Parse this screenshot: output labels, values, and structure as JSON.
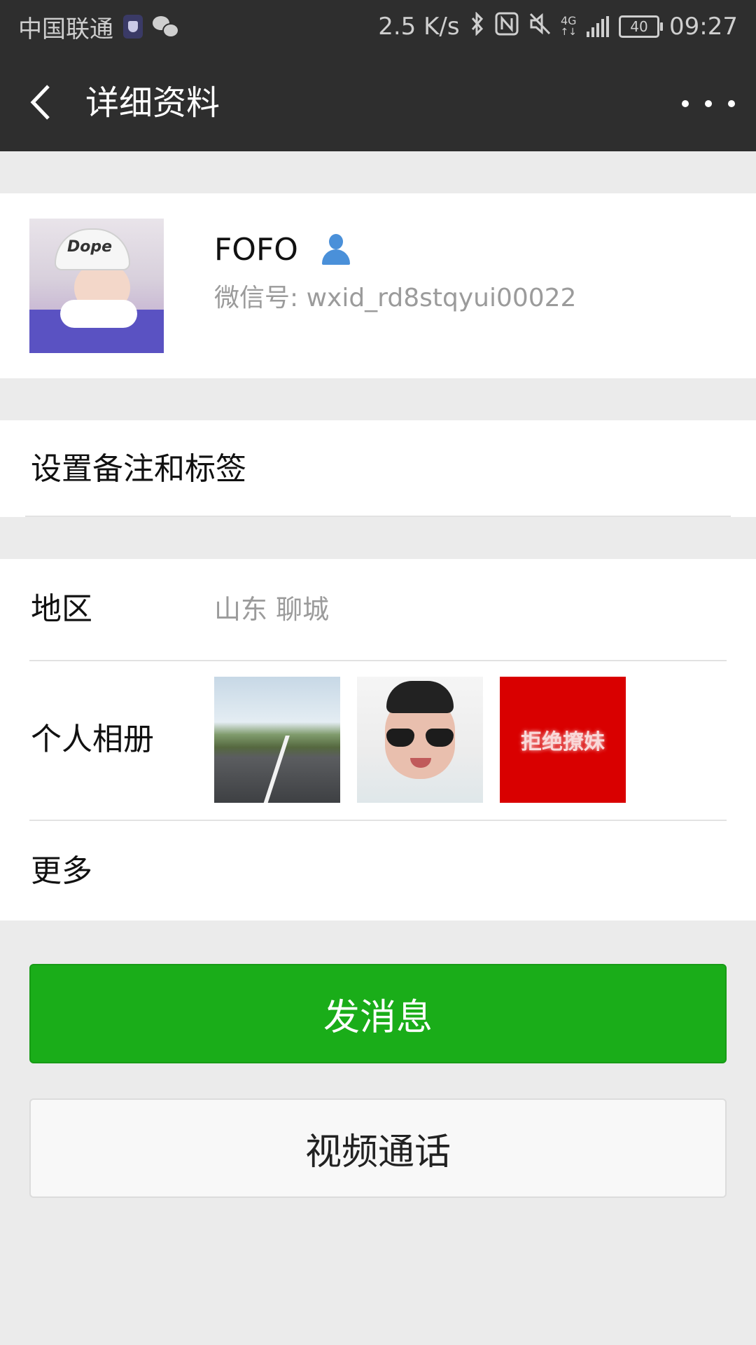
{
  "status_bar": {
    "carrier": "中国联通",
    "speed": "2.5 K/s",
    "network": "4G",
    "battery": "40",
    "time": "09:27",
    "icons": [
      "shield-icon",
      "wechat-icon",
      "bluetooth-icon",
      "nfc-icon",
      "mute-icon",
      "signal-icon",
      "battery-icon"
    ]
  },
  "navbar": {
    "title": "详细资料",
    "back_icon": "chevron-left-icon",
    "more_icon": "more-dots-icon"
  },
  "profile": {
    "name": "FOFO",
    "wechat_id": "微信号: wxid_rd8stqyui00022",
    "contact_icon": "contact-person-icon",
    "cap_text": "Dope"
  },
  "remark": {
    "label": "设置备注和标签"
  },
  "info": {
    "region_label": "地区",
    "region_value": "山东  聊城",
    "album_label": "个人相册",
    "album_thumbs": [
      "road-photo",
      "selfie-photo",
      "拒绝撩妹"
    ],
    "more_label": "更多"
  },
  "actions": {
    "message": "发消息",
    "video_call": "视频通话"
  },
  "colors": {
    "header_bg": "#2e2e2e",
    "primary_green": "#1aad19",
    "page_bg": "#ebebeb",
    "secondary_text": "#9b9b9b",
    "contact_icon_blue": "#4a90d9"
  }
}
